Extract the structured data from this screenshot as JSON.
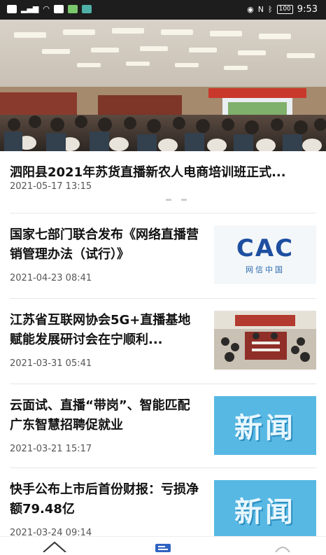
{
  "status_bar": {
    "time": "9:53",
    "battery": "100"
  },
  "hero": {
    "title": "泗阳县2021年苏货直播新农人电商培训班正式...",
    "date": "2021-05-17 13:15"
  },
  "news": [
    {
      "title": "国家七部门联合发布《网络直播营销管理办法（试行）》",
      "date": "2021-04-23 08:41",
      "thumb": "cac-logo"
    },
    {
      "title": "江苏省互联网协会5G+直播基地赋能发展研讨会在宁顺利...",
      "date": "2021-03-31 05:41",
      "thumb": "meeting-photo"
    },
    {
      "title": "云面试、直播“带岗”、智能匹配 广东智慧招聘促就业",
      "date": "2021-03-21 15:17",
      "thumb": "news-badge"
    },
    {
      "title": "快手公布上市后首份财报：亏损净额79.48亿",
      "date": "2021-03-24 09:14",
      "thumb": "news-badge"
    }
  ],
  "cac_logo": {
    "mark": "CAC",
    "sub": "网信中国"
  },
  "news_badge": {
    "text": "新闻"
  },
  "colors": {
    "accent": "#2f63c2",
    "badge": "#57b8e3",
    "cac": "#1e4fa0"
  },
  "icons": {
    "nav_home": "home-icon",
    "nav_news": "news-icon",
    "nav_profile": "profile-icon"
  }
}
